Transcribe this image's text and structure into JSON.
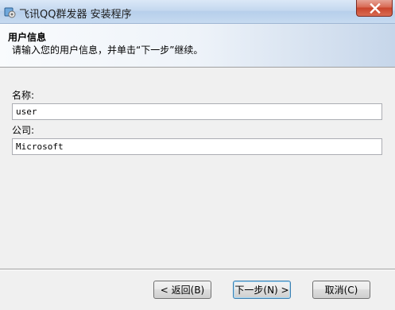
{
  "window": {
    "title": "飞讯QQ群发器 安装程序"
  },
  "header": {
    "title": "用户信息",
    "subtitle": "请输入您的用户信息，并单击“下一步”继续。"
  },
  "form": {
    "name_label": "名称:",
    "name_value": "user",
    "company_label": "公司:",
    "company_value": "Microsoft"
  },
  "buttons": {
    "back": "< 返回(B)",
    "next": "下一步(N) >",
    "cancel": "取消(C)"
  },
  "icons": {
    "app": "installer-icon",
    "close": "close-icon"
  },
  "colors": {
    "close_button": "#c9452c",
    "header_gradient_end": "#c6d6ea"
  }
}
